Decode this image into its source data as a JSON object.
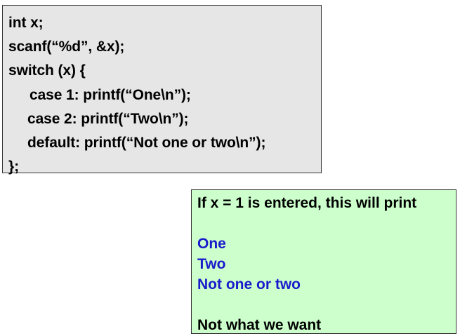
{
  "code": {
    "lines": [
      "int x;",
      "scanf(“%d”, &x);",
      "switch (x) {",
      "case 1: printf(“One\\n”);",
      "case 2: printf(“Two\\n”);",
      "default: printf(“Not one or two\\n”);",
      "};"
    ]
  },
  "note": {
    "intro": "If x = 1 is entered, this will print",
    "outputs": [
      "One",
      "Two",
      "Not one or two"
    ],
    "conclusion": "Not what we want"
  },
  "colors": {
    "code_background": "#e6e6e6",
    "note_background": "#ccffcc",
    "output_text": "#1a1acc",
    "border": "#333333"
  }
}
